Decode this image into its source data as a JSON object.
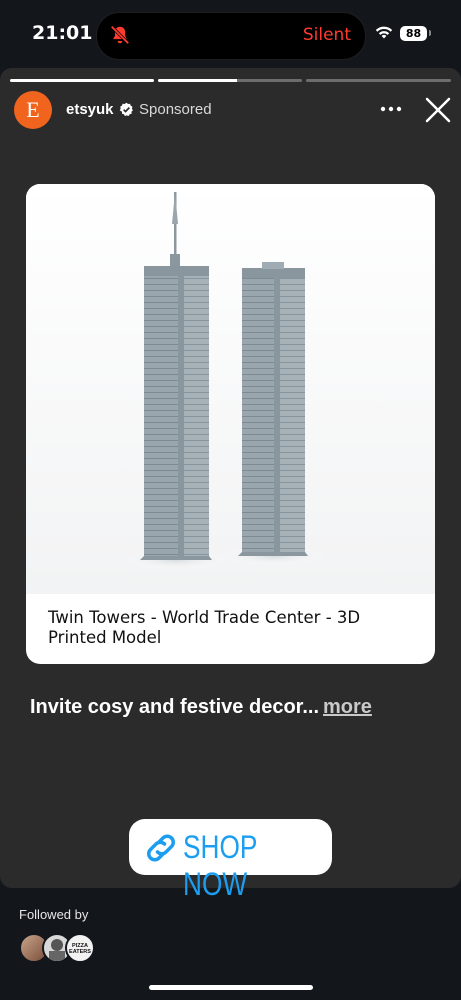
{
  "status_bar": {
    "time": "21:01",
    "silent_label": "Silent",
    "battery": "88",
    "icons": [
      "bell-slash-icon",
      "wifi-icon",
      "battery-icon"
    ]
  },
  "story": {
    "progress": [
      {
        "segment": 1,
        "fill": 1.0
      },
      {
        "segment": 2,
        "fill": 0.55
      },
      {
        "segment": 3,
        "fill": 0.0
      }
    ],
    "account": {
      "avatar_letter": "E",
      "username": "etsyuk",
      "label": "Sponsored",
      "brand_color": "#f1641e"
    },
    "product": {
      "title": "Twin Towers - World Trade Center - 3D Printed Model"
    },
    "caption": {
      "text": "Invite cosy and festive decor...",
      "more_label": "more"
    },
    "cta": {
      "label": "SHOP NOW",
      "icon": "link-icon",
      "color": "#1c9ef0"
    }
  },
  "footer": {
    "followed_by_label": "Followed by",
    "pizza_text_1": "PIZZA",
    "pizza_text_2": "EATERS"
  }
}
